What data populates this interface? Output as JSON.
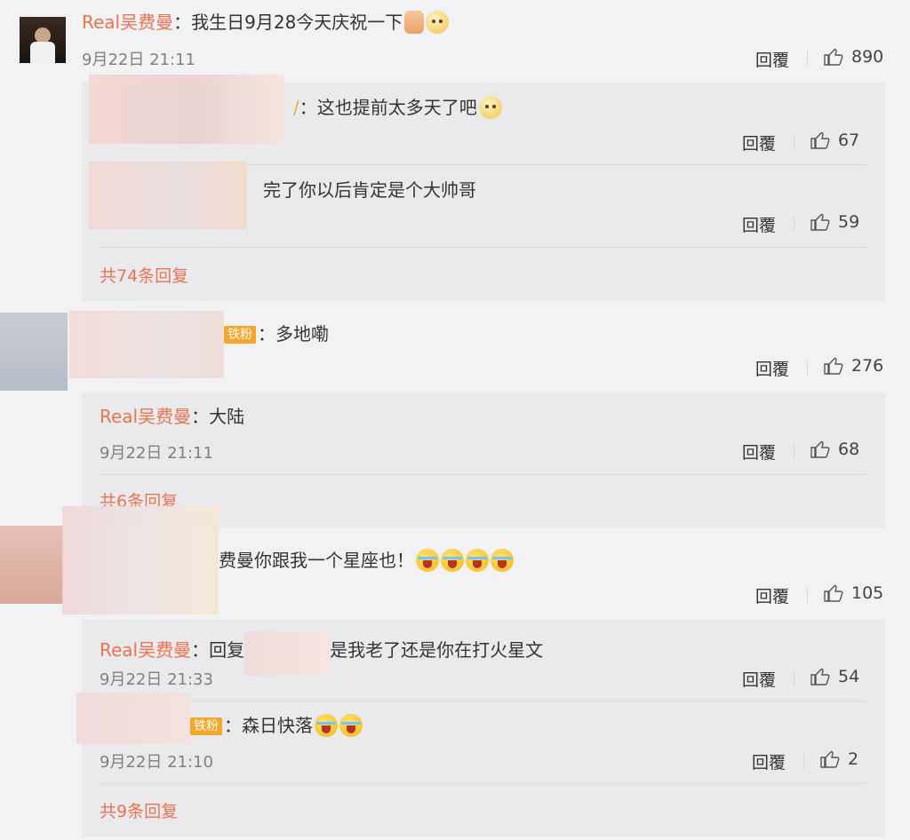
{
  "reply_label": "回覆",
  "comments": [
    {
      "user": "Real吴费曼",
      "text": "：我生日9月28今天庆祝一下",
      "time": "9月22日 21:11",
      "likes": "890",
      "replies": [
        {
          "text": "：这也提前太多天了吧",
          "likes": "67"
        },
        {
          "text": "完了你以后肯定是个大帅哥",
          "likes": "59"
        }
      ],
      "more": "共74条回复"
    },
    {
      "badge": "铁粉",
      "text": "：多地嘞",
      "likes": "276",
      "replies": [
        {
          "user": "Real吴费曼",
          "text": "：大陆",
          "time": "9月22日 21:11",
          "likes": "68"
        }
      ],
      "more": "共6条回复"
    },
    {
      "text": "费曼你跟我一个星座也！",
      "likes": "105",
      "replies": [
        {
          "user": "Real吴费曼",
          "text_a": "：回复",
          "text_b": "是我老了还是你在打火星文",
          "time": "9月22日 21:33",
          "likes": "54"
        },
        {
          "badge": "铁粉",
          "text": "：森日快落",
          "time": "9月22日 21:10",
          "likes": "2"
        }
      ],
      "more": "共9条回复"
    }
  ]
}
